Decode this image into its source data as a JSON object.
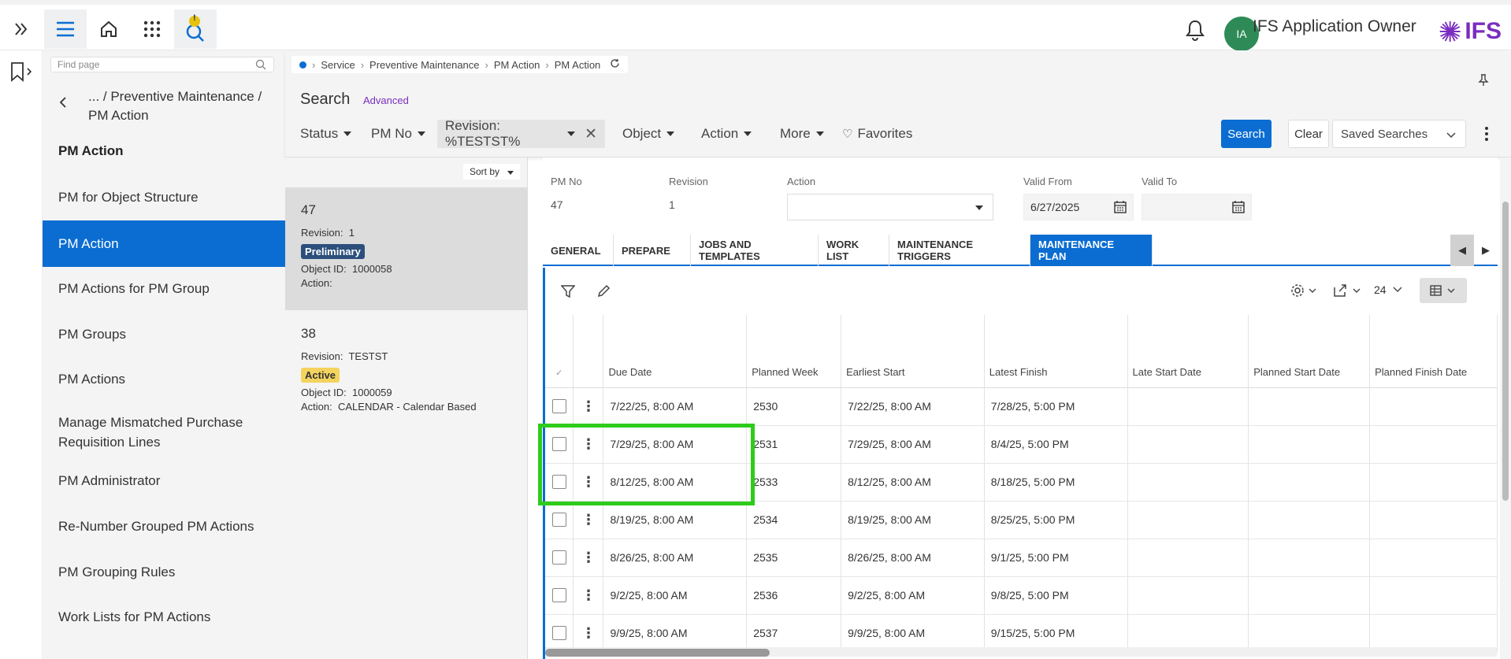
{
  "topbar": {
    "user_initials": "IA",
    "user_name": "IFS Application Owner",
    "logo_text": "IFS",
    "notification_badge": "!"
  },
  "nav": {
    "find_placeholder": "Find page",
    "breadcrumb": "... / Preventive Maintenance / PM Action",
    "heading": "PM Action",
    "items": [
      {
        "label": "PM for Object Structure"
      },
      {
        "label": "PM Action"
      },
      {
        "label": "PM Actions for PM Group"
      },
      {
        "label": "PM Groups"
      },
      {
        "label": "PM Actions"
      },
      {
        "label": "Manage Mismatched Purchase Requisition Lines"
      },
      {
        "label": "PM Administrator"
      },
      {
        "label": "Re-Number Grouped PM Actions"
      },
      {
        "label": "PM Grouping Rules"
      },
      {
        "label": "Work Lists for PM Actions"
      }
    ]
  },
  "breadcrumb": {
    "items": [
      "Service",
      "Preventive Maintenance",
      "PM Action",
      "PM Action"
    ]
  },
  "search": {
    "title": "Search",
    "advanced": "Advanced",
    "filters": {
      "status": "Status",
      "pm_no": "PM No",
      "revision": "Revision: %TESTST%",
      "object": "Object",
      "action": "Action",
      "more": "More",
      "favorites": "Favorites"
    },
    "search_button": "Search",
    "clear_button": "Clear",
    "saved_searches": "Saved Searches"
  },
  "list": {
    "sort_by": "Sort by",
    "cards": [
      {
        "number": "47",
        "revision_label": "Revision:",
        "revision": "1",
        "status": "Preliminary",
        "object_label": "Object ID:",
        "object_id": "1000058",
        "action_label": "Action:",
        "action": ""
      },
      {
        "number": "38",
        "revision_label": "Revision:",
        "revision": "TESTST",
        "status": "Active",
        "object_label": "Object ID:",
        "object_id": "1000059",
        "action_label": "Action:",
        "action": "CALENDAR - Calendar Based"
      }
    ]
  },
  "detail": {
    "header": {
      "pm_no_label": "PM No",
      "pm_no": "47",
      "revision_label": "Revision",
      "revision": "1",
      "action_label": "Action",
      "action": "",
      "valid_from_label": "Valid From",
      "valid_from": "6/27/2025",
      "valid_to_label": "Valid To",
      "valid_to": ""
    },
    "tabs": [
      "GENERAL",
      "PREPARE",
      "JOBS AND TEMPLATES",
      "WORK LIST",
      "MAINTENANCE TRIGGERS",
      "MAINTENANCE PLAN"
    ],
    "active_tab": "MAINTENANCE PLAN",
    "page_size": "24"
  },
  "grid": {
    "columns": [
      "Due Date",
      "Planned Week",
      "Earliest Start",
      "Latest Finish",
      "Late Start Date",
      "Planned Start Date",
      "Planned Finish Date"
    ],
    "rows": [
      [
        "7/22/25, 8:00 AM",
        "2530",
        "7/22/25, 8:00 AM",
        "7/28/25, 5:00 PM",
        "",
        "",
        ""
      ],
      [
        "7/29/25, 8:00 AM",
        "2531",
        "7/29/25, 8:00 AM",
        "8/4/25, 5:00 PM",
        "",
        "",
        ""
      ],
      [
        "8/12/25, 8:00 AM",
        "2533",
        "8/12/25, 8:00 AM",
        "8/18/25, 5:00 PM",
        "",
        "",
        ""
      ],
      [
        "8/19/25, 8:00 AM",
        "2534",
        "8/19/25, 8:00 AM",
        "8/25/25, 5:00 PM",
        "",
        "",
        ""
      ],
      [
        "8/26/25, 8:00 AM",
        "2535",
        "8/26/25, 8:00 AM",
        "9/1/25, 5:00 PM",
        "",
        "",
        ""
      ],
      [
        "9/2/25, 8:00 AM",
        "2536",
        "9/2/25, 8:00 AM",
        "9/8/25, 5:00 PM",
        "",
        "",
        ""
      ],
      [
        "9/9/25, 8:00 AM",
        "2537",
        "9/9/25, 8:00 AM",
        "9/15/25, 5:00 PM",
        "",
        "",
        ""
      ]
    ]
  },
  "colors": {
    "accent": "#0b6dd1",
    "highlight": "#2ecc1a",
    "brand": "#7a2dc0"
  }
}
